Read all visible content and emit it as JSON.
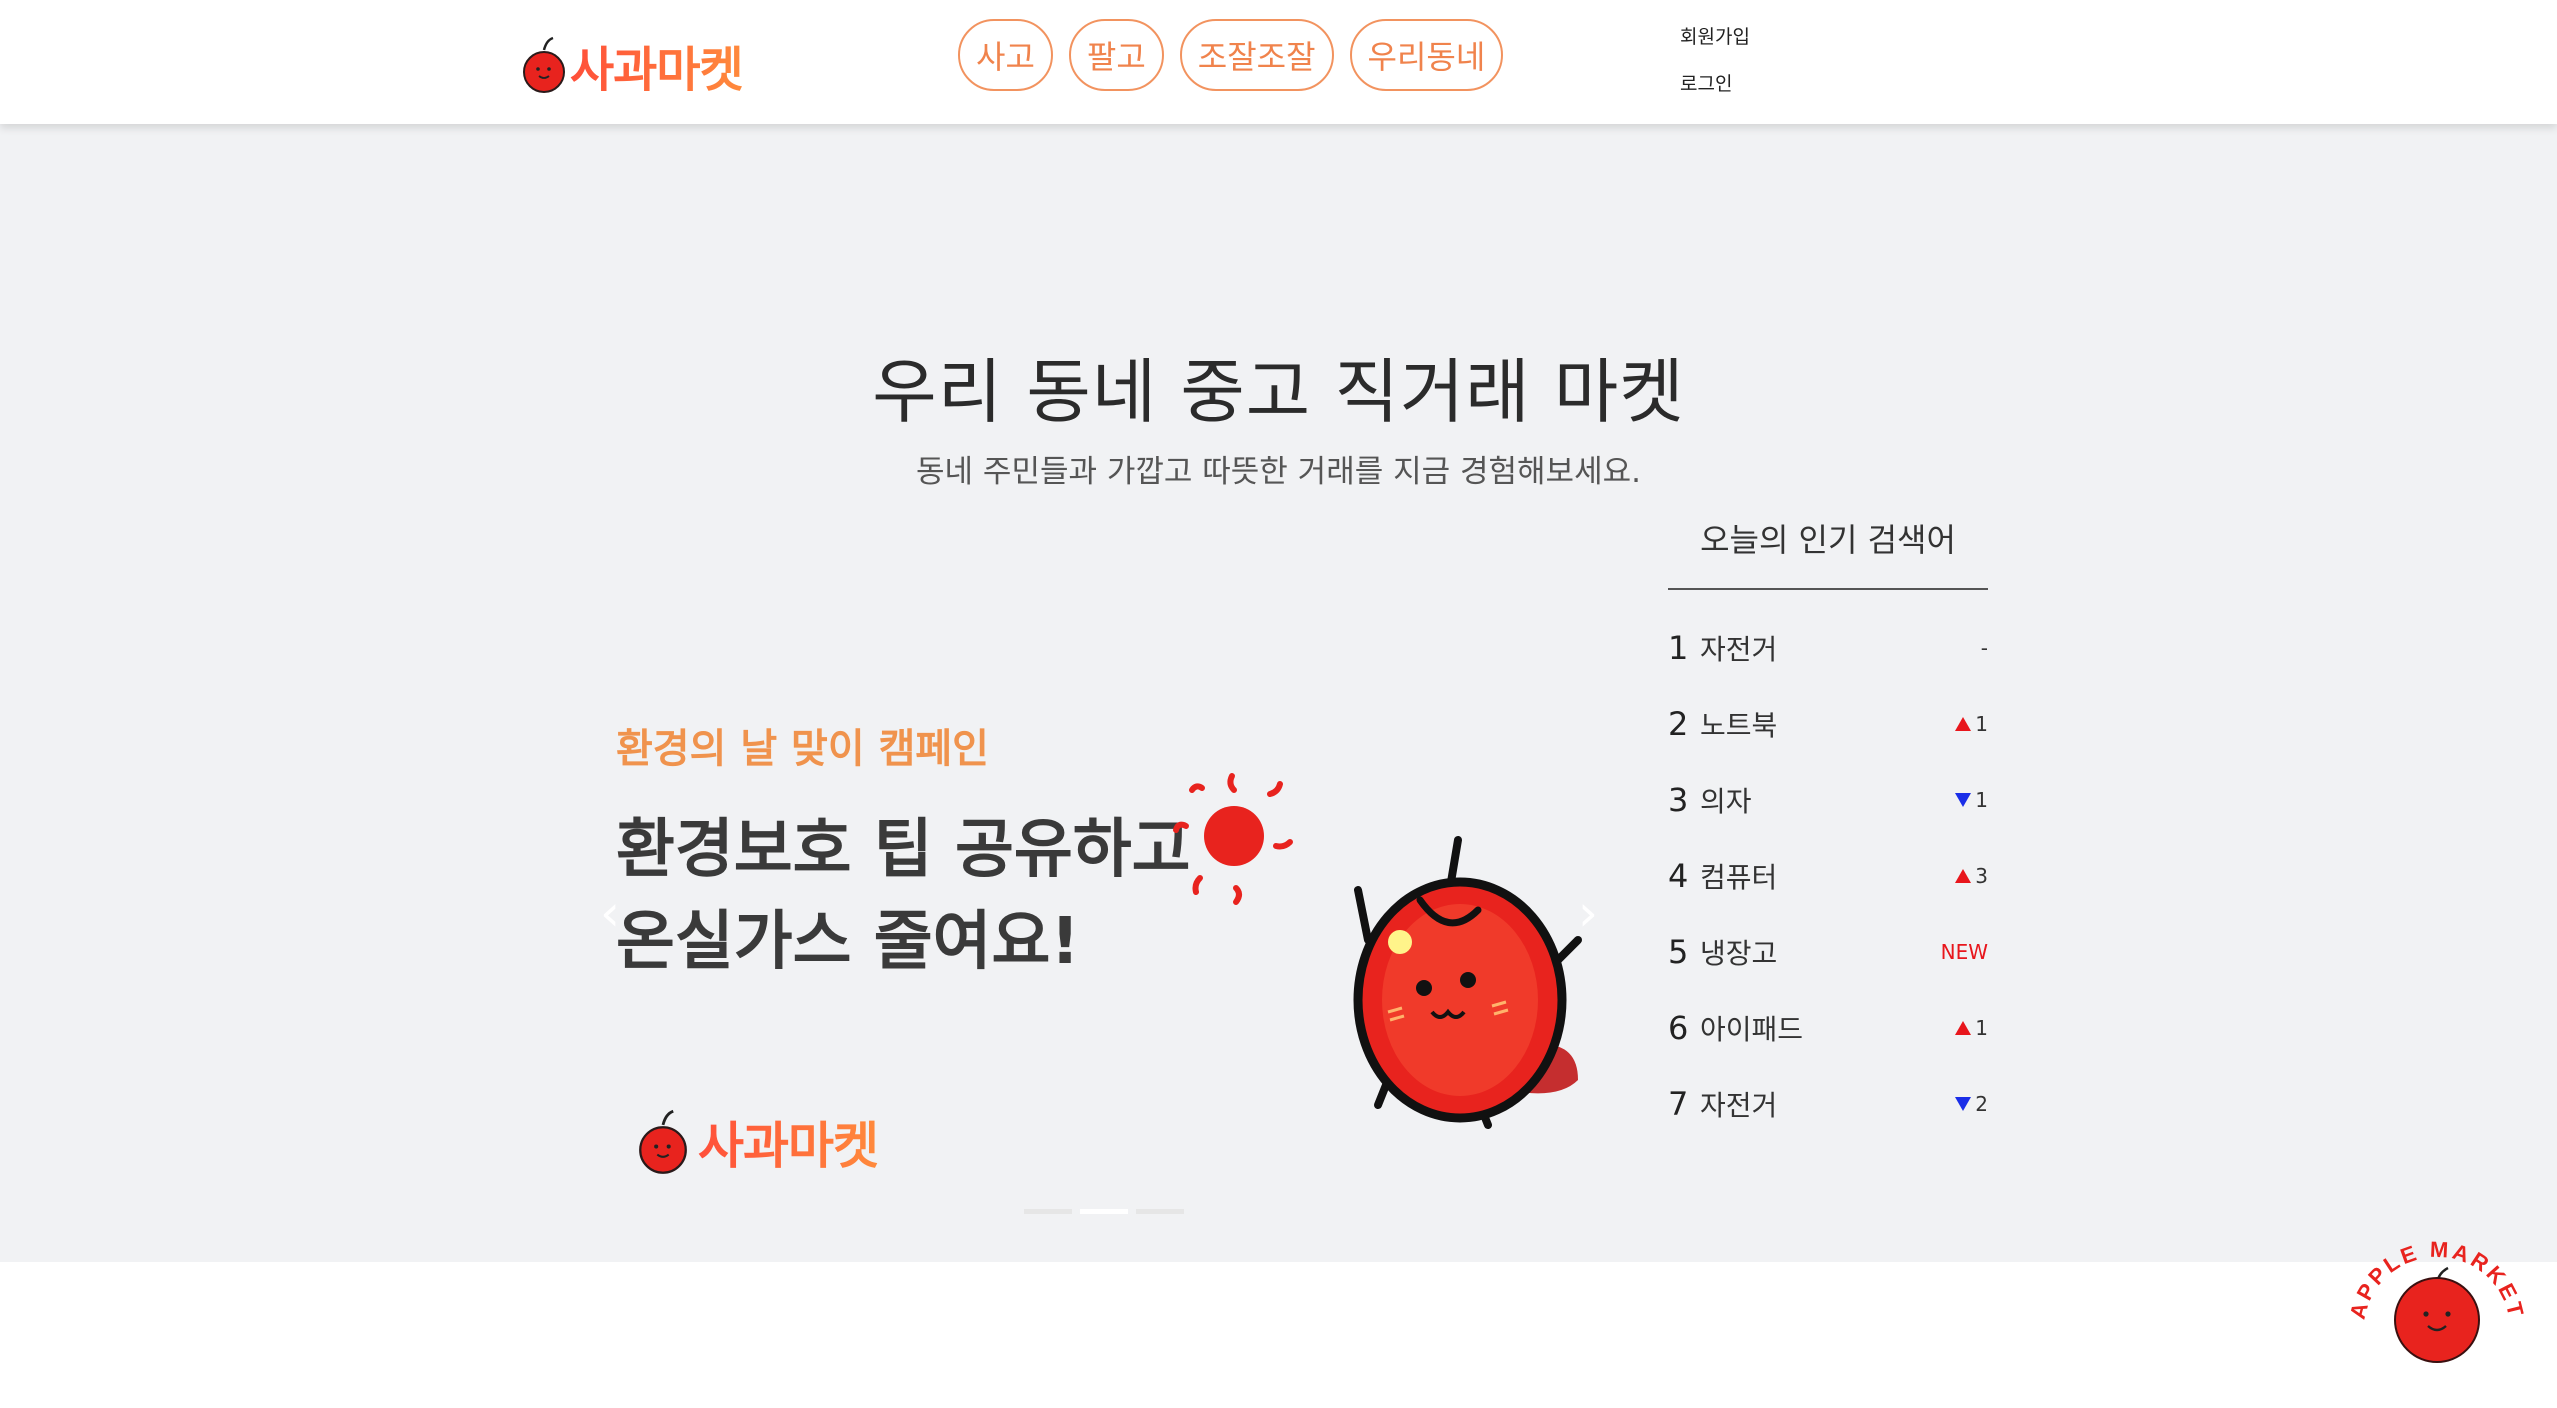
{
  "header": {
    "logo_text": "사과마켓",
    "nav": [
      "사고",
      "팔고",
      "조잘조잘",
      "우리동네"
    ],
    "signup": "회원가입",
    "login": "로그인"
  },
  "hero": {
    "title": "우리 동네 중고 직거래 마켓",
    "subtitle": "동네 주민들과 가깝고 따뜻한 거래를 지금 경험해보세요."
  },
  "banner": {
    "campaign": "환경의 날 맞이 캠페인",
    "headline_line1": "환경보호 팁 공유하고",
    "headline_line2": "온실가스 줄여요!",
    "logo_text": "사과마켓",
    "prev_arrow": "‹",
    "next_arrow": "›",
    "slides": 3,
    "active_slide": 2
  },
  "popular": {
    "title": "오늘의 인기 검색어",
    "items": [
      {
        "rank": "1",
        "term": "자전거",
        "change": "-",
        "dir": "none"
      },
      {
        "rank": "2",
        "term": "노트북",
        "change": "1",
        "dir": "up"
      },
      {
        "rank": "3",
        "term": "의자",
        "change": "1",
        "dir": "down"
      },
      {
        "rank": "4",
        "term": "컴퓨터",
        "change": "3",
        "dir": "up"
      },
      {
        "rank": "5",
        "term": "냉장고",
        "change": "NEW",
        "dir": "new"
      },
      {
        "rank": "6",
        "term": "아이패드",
        "change": "1",
        "dir": "up"
      },
      {
        "rank": "7",
        "term": "자전거",
        "change": "2",
        "dir": "down"
      }
    ]
  },
  "floating_badge": {
    "text": "APPLE MARKET"
  },
  "colors": {
    "accent": "#f0834c",
    "hero_bg": "#f1f2f4",
    "apple_red": "#e8231e",
    "rank_up": "#e8161c",
    "rank_down": "#1a2ee8"
  }
}
